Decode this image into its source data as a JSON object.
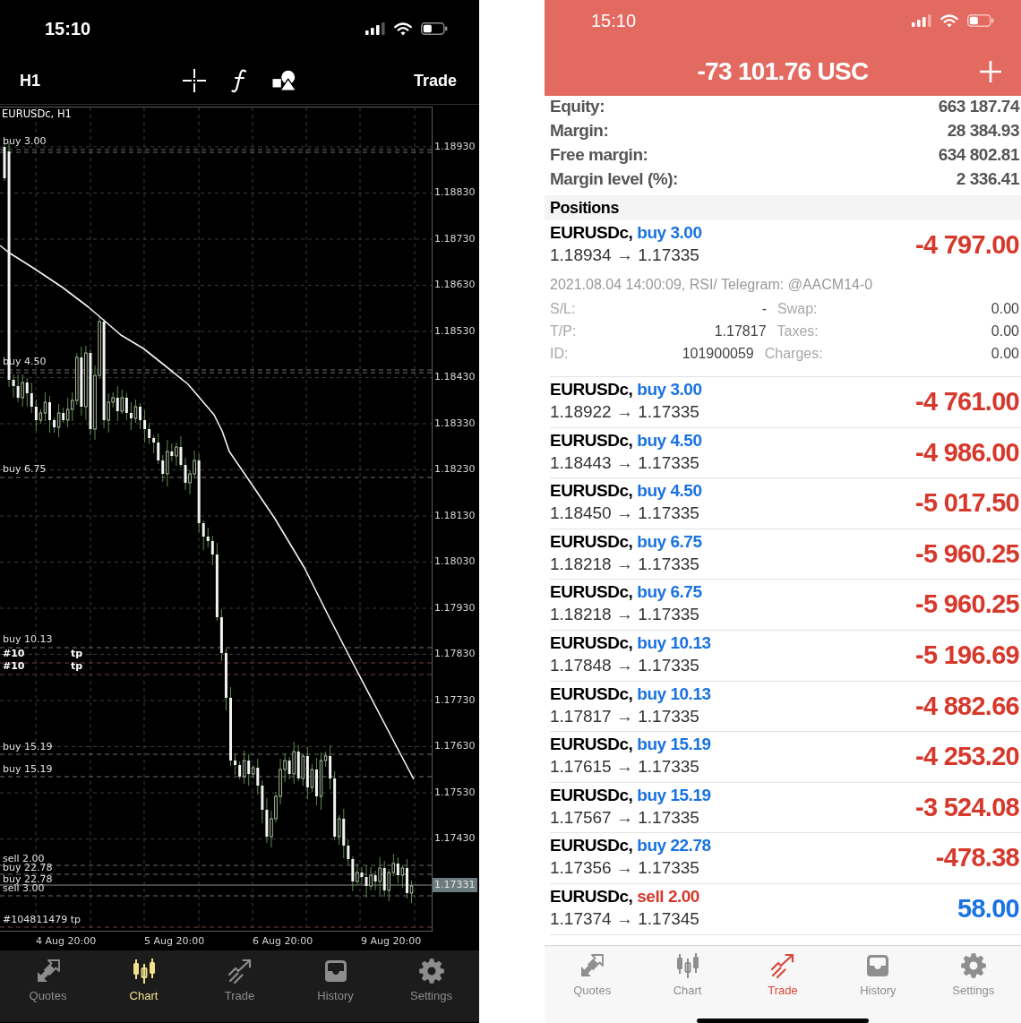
{
  "left_phone": {
    "status_bar": {
      "time": "15:10"
    },
    "toolbar": {
      "timeframe": "H1",
      "action": "Trade"
    },
    "chart": {
      "title": "EURUSDc, H1",
      "price_ticks": [
        "1.18930",
        "1.18830",
        "1.18730",
        "1.18630",
        "1.18530",
        "1.18430",
        "1.18330",
        "1.18230",
        "1.18130",
        "1.18030",
        "1.17930",
        "1.17830",
        "1.17730",
        "1.17630",
        "1.17530",
        "1.17430"
      ],
      "current_price": "1.17331",
      "date_ticks": [
        "4 Aug 20:00",
        "5 Aug 20:00",
        "6 Aug 20:00",
        "9 Aug 20:00"
      ],
      "order_labels": [
        {
          "kind": "order",
          "text": "buy 3.00"
        },
        {
          "kind": "order",
          "text": "buy 4.50"
        },
        {
          "kind": "order",
          "text": "buy 6.75"
        },
        {
          "kind": "order",
          "text": "buy 10.13"
        },
        {
          "kind": "overlapped",
          "text": "#10",
          "suffix": "tp"
        },
        {
          "kind": "overlapped",
          "text": "#10",
          "suffix": "tp"
        },
        {
          "kind": "order",
          "text": "buy 15.19"
        },
        {
          "kind": "order",
          "text": "buy 15.19"
        },
        {
          "kind": "order",
          "text": "sell 2.00"
        },
        {
          "kind": "order",
          "text": "buy 22.78"
        },
        {
          "kind": "order",
          "text": "buy 22.78"
        },
        {
          "kind": "order",
          "text": "sell 3.00"
        },
        {
          "kind": "order",
          "text": "#104811479 tp"
        }
      ]
    },
    "tab_bar": [
      {
        "label": "Quotes",
        "selected": false
      },
      {
        "label": "Chart",
        "selected": true
      },
      {
        "label": "Trade",
        "selected": false
      },
      {
        "label": "History",
        "selected": false
      },
      {
        "label": "Settings",
        "selected": false
      }
    ]
  },
  "right_phone": {
    "status_bar": {
      "time": "15:10"
    },
    "header": {
      "balance": "-73 101.76 USC"
    },
    "account": [
      {
        "label": "Equity:",
        "value": "663 187.74"
      },
      {
        "label": "Margin:",
        "value": "28 384.93"
      },
      {
        "label": "Free margin:",
        "value": "634 802.81"
      },
      {
        "label": "Margin level (%):",
        "value": "2 336.41"
      }
    ],
    "positions_title": "Positions",
    "positions": [
      {
        "symbol": "EURUSDc,",
        "order": "buy 3.00",
        "kind": "buy",
        "prices": "1.18934 → 1.17335",
        "profit": "-4 797.00",
        "loss": true,
        "expanded": true,
        "details": {
          "comment": "2021.08.04 14:00:09, RSI/ Telegram: @AACM14-0",
          "grid": [
            [
              "S/L:",
              "-",
              "Swap:",
              "0.00"
            ],
            [
              "T/P:",
              "1.17817",
              "Taxes:",
              "0.00"
            ],
            [
              "ID:",
              "101900059",
              "Charges:",
              "0.00"
            ]
          ]
        }
      },
      {
        "symbol": "EURUSDc,",
        "order": "buy 3.00",
        "kind": "buy",
        "prices": "1.18922 → 1.17335",
        "profit": "-4 761.00",
        "loss": true,
        "expanded": false
      },
      {
        "symbol": "EURUSDc,",
        "order": "buy 4.50",
        "kind": "buy",
        "prices": "1.18443 → 1.17335",
        "profit": "-4 986.00",
        "loss": true,
        "expanded": false
      },
      {
        "symbol": "EURUSDc,",
        "order": "buy 4.50",
        "kind": "buy",
        "prices": "1.18450 → 1.17335",
        "profit": "-5 017.50",
        "loss": true,
        "expanded": false
      },
      {
        "symbol": "EURUSDc,",
        "order": "buy 6.75",
        "kind": "buy",
        "prices": "1.18218 → 1.17335",
        "profit": "-5 960.25",
        "loss": true,
        "expanded": false
      },
      {
        "symbol": "EURUSDc,",
        "order": "buy 6.75",
        "kind": "buy",
        "prices": "1.18218 → 1.17335",
        "profit": "-5 960.25",
        "loss": true,
        "expanded": false
      },
      {
        "symbol": "EURUSDc,",
        "order": "buy 10.13",
        "kind": "buy",
        "prices": "1.17848 → 1.17335",
        "profit": "-5 196.69",
        "loss": true,
        "expanded": false
      },
      {
        "symbol": "EURUSDc,",
        "order": "buy 10.13",
        "kind": "buy",
        "prices": "1.17817 → 1.17335",
        "profit": "-4 882.66",
        "loss": true,
        "expanded": false
      },
      {
        "symbol": "EURUSDc,",
        "order": "buy 15.19",
        "kind": "buy",
        "prices": "1.17615 → 1.17335",
        "profit": "-4 253.20",
        "loss": true,
        "expanded": false
      },
      {
        "symbol": "EURUSDc,",
        "order": "buy 15.19",
        "kind": "buy",
        "prices": "1.17567 → 1.17335",
        "profit": "-3 524.08",
        "loss": true,
        "expanded": false
      },
      {
        "symbol": "EURUSDc,",
        "order": "buy 22.78",
        "kind": "buy",
        "prices": "1.17356 → 1.17335",
        "profit": "-478.38",
        "loss": true,
        "expanded": false
      },
      {
        "symbol": "EURUSDc,",
        "order": "sell 2.00",
        "kind": "sell",
        "prices": "1.17374 → 1.17345",
        "profit": "58.00",
        "loss": false,
        "expanded": false
      }
    ],
    "tab_bar": [
      {
        "label": "Quotes",
        "selected": false
      },
      {
        "label": "Chart",
        "selected": false
      },
      {
        "label": "Trade",
        "selected": true
      },
      {
        "label": "History",
        "selected": false
      },
      {
        "label": "Settings",
        "selected": false
      }
    ]
  }
}
